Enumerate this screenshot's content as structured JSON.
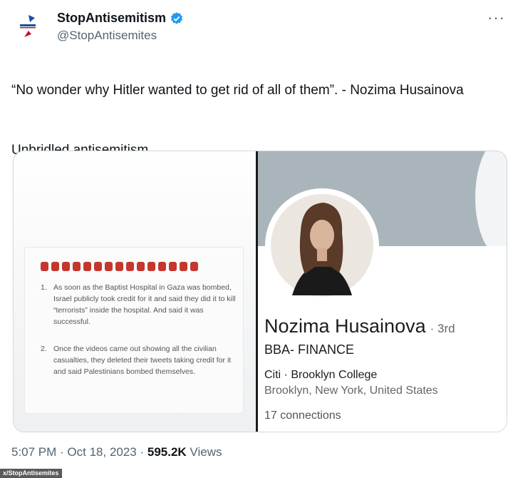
{
  "account": {
    "display_name": "StopAntisemitism",
    "handle": "@StopAntisemites",
    "verified_icon": "verified-badge-icon",
    "avatar_icon": "stopantisemitism-logo-icon"
  },
  "more_icon": "more-options-icon",
  "more_label": "···",
  "tweet": {
    "line1": "“No wonder why Hitler wanted to get rid of all of them”. - Nozima Husainova",
    "line2": "Unbridled antisemitism."
  },
  "media": {
    "left": {
      "items": [
        {
          "num": "1.",
          "text": "As soon as the Baptist Hospital in Gaza was bombed, Israel publicly took credit for it and said they did it to kill “terrorists” inside the hospital. And said it was successful."
        },
        {
          "num": "2.",
          "text": "Once the videos came out showing all the civilian casualties, they deleted their tweets taking credit for it and said Palestinians bombed themselves."
        }
      ],
      "emoji_icon": "red-flag-emoji-icon",
      "emoji_count": 15
    },
    "right": {
      "name": "Nozima Husainova",
      "degree": "· 3rd",
      "headline": "BBA- FINANCE",
      "company": "Citi · Brooklyn College",
      "location": "Brooklyn, New York, United States",
      "connections": "17 connections"
    }
  },
  "meta": {
    "time": "5:07 PM · Oct 18, 2023 · ",
    "views_count": "595.2K",
    "views_label": " Views"
  },
  "credit": "x/StopAntisemites",
  "colors": {
    "verified": "#1d9bf0",
    "text_secondary": "#536471",
    "banner": "#a9b5bb"
  }
}
